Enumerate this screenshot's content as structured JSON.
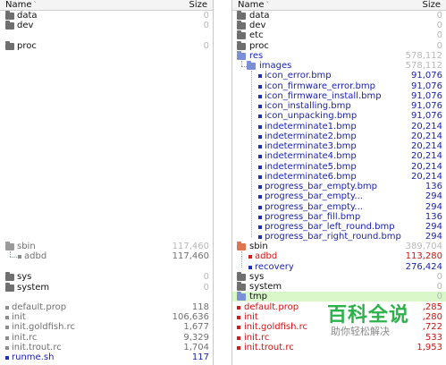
{
  "left": {
    "header": {
      "name": "Name",
      "size": "Size"
    },
    "rows": [
      {
        "name": "data",
        "size": "0"
      },
      {
        "name": "dev",
        "size": "0"
      },
      {
        "name": "proc",
        "size": "0"
      },
      {
        "name": "sbin",
        "size": "117,460"
      },
      {
        "name": "adbd",
        "size": "117,460"
      },
      {
        "name": "sys",
        "size": "0"
      },
      {
        "name": "system",
        "size": "0"
      },
      {
        "name": "default.prop",
        "size": "118"
      },
      {
        "name": "init",
        "size": "106,636"
      },
      {
        "name": "init.goldfish.rc",
        "size": "1,677"
      },
      {
        "name": "init.rc",
        "size": "9,329"
      },
      {
        "name": "init.trout.rc",
        "size": "1,704"
      },
      {
        "name": "runme.sh",
        "size": "117"
      }
    ]
  },
  "right": {
    "header": {
      "name": "Name",
      "size": "Size"
    },
    "rows": [
      {
        "name": "data",
        "size": "0"
      },
      {
        "name": "dev",
        "size": "0"
      },
      {
        "name": "etc",
        "size": "0"
      },
      {
        "name": "proc",
        "size": "0"
      },
      {
        "name": "res",
        "size": "578,112"
      },
      {
        "name": "images",
        "size": "578,112"
      },
      {
        "name": "icon_error.bmp",
        "size": "91,076"
      },
      {
        "name": "icon_firmware_error.bmp",
        "size": "91,076"
      },
      {
        "name": "icon_firmware_install.bmp",
        "size": "91,076"
      },
      {
        "name": "icon_installing.bmp",
        "size": "91,076"
      },
      {
        "name": "icon_unpacking.bmp",
        "size": "91,076"
      },
      {
        "name": "indeterminate1.bmp",
        "size": "20,214"
      },
      {
        "name": "indeterminate2.bmp",
        "size": "20,214"
      },
      {
        "name": "indeterminate3.bmp",
        "size": "20,214"
      },
      {
        "name": "indeterminate4.bmp",
        "size": "20,214"
      },
      {
        "name": "indeterminate5.bmp",
        "size": "20,214"
      },
      {
        "name": "indeterminate6.bmp",
        "size": "20,214"
      },
      {
        "name": "progress_bar_empty.bmp",
        "size": "136"
      },
      {
        "name": "progress_bar_empty...",
        "size": "294"
      },
      {
        "name": "progress_bar_empty...",
        "size": "294"
      },
      {
        "name": "progress_bar_fill.bmp",
        "size": "136"
      },
      {
        "name": "progress_bar_left_round.bmp",
        "size": "294"
      },
      {
        "name": "progress_bar_right_round.bmp",
        "size": "294"
      },
      {
        "name": "sbin",
        "size": "389,704"
      },
      {
        "name": "adbd",
        "size": "113,280"
      },
      {
        "name": "recovery",
        "size": "276,424"
      },
      {
        "name": "sys",
        "size": "0"
      },
      {
        "name": "system",
        "size": "0"
      },
      {
        "name": "tmp",
        "size": "0"
      },
      {
        "name": "default.prop",
        "size": ",285"
      },
      {
        "name": "init",
        "size": ",280"
      },
      {
        "name": "init.goldfish.rc",
        "size": ",722"
      },
      {
        "name": "init.rc",
        "size": "533"
      },
      {
        "name": "init.trout.rc",
        "size": "1,953"
      }
    ]
  },
  "watermark": {
    "title": "百科全说",
    "subtitle": "助你轻松解决"
  },
  "colors": {
    "blue_text": "#1a22b0",
    "red_text": "#d40f0f",
    "highlight": "#d9f7c8"
  }
}
